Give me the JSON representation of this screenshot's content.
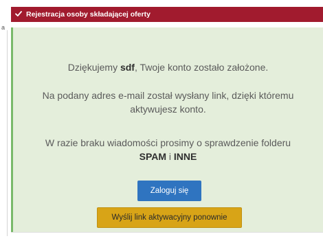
{
  "side": {
    "fragment": "a"
  },
  "panel": {
    "title": "Rejestracja osoby składającej oferty",
    "header_icon": "check-icon",
    "colors": {
      "header_bg": "#a11b2e",
      "content_bg": "#e4eedb",
      "accent_border": "#79b96a",
      "login_button": "#2f74c0",
      "resend_button": "#d8a417"
    }
  },
  "message": {
    "thanks_prefix": "Dziękujemy ",
    "username": "sdf",
    "thanks_suffix": ", Twoje konto zostało założone.",
    "email_line1": "Na podany adres e-mail został wysłany link, dzięki któremu",
    "email_line2": "aktywujesz konto.",
    "spam_line1": "W razie braku wiadomości prosimy o sprawdzenie folderu",
    "spam_folder": "SPAM",
    "spam_conjunction": " i ",
    "inne_folder": "INNE"
  },
  "buttons": {
    "login_label": "Zaloguj się",
    "resend_label": "Wyślij link aktywacyjny ponownie"
  }
}
